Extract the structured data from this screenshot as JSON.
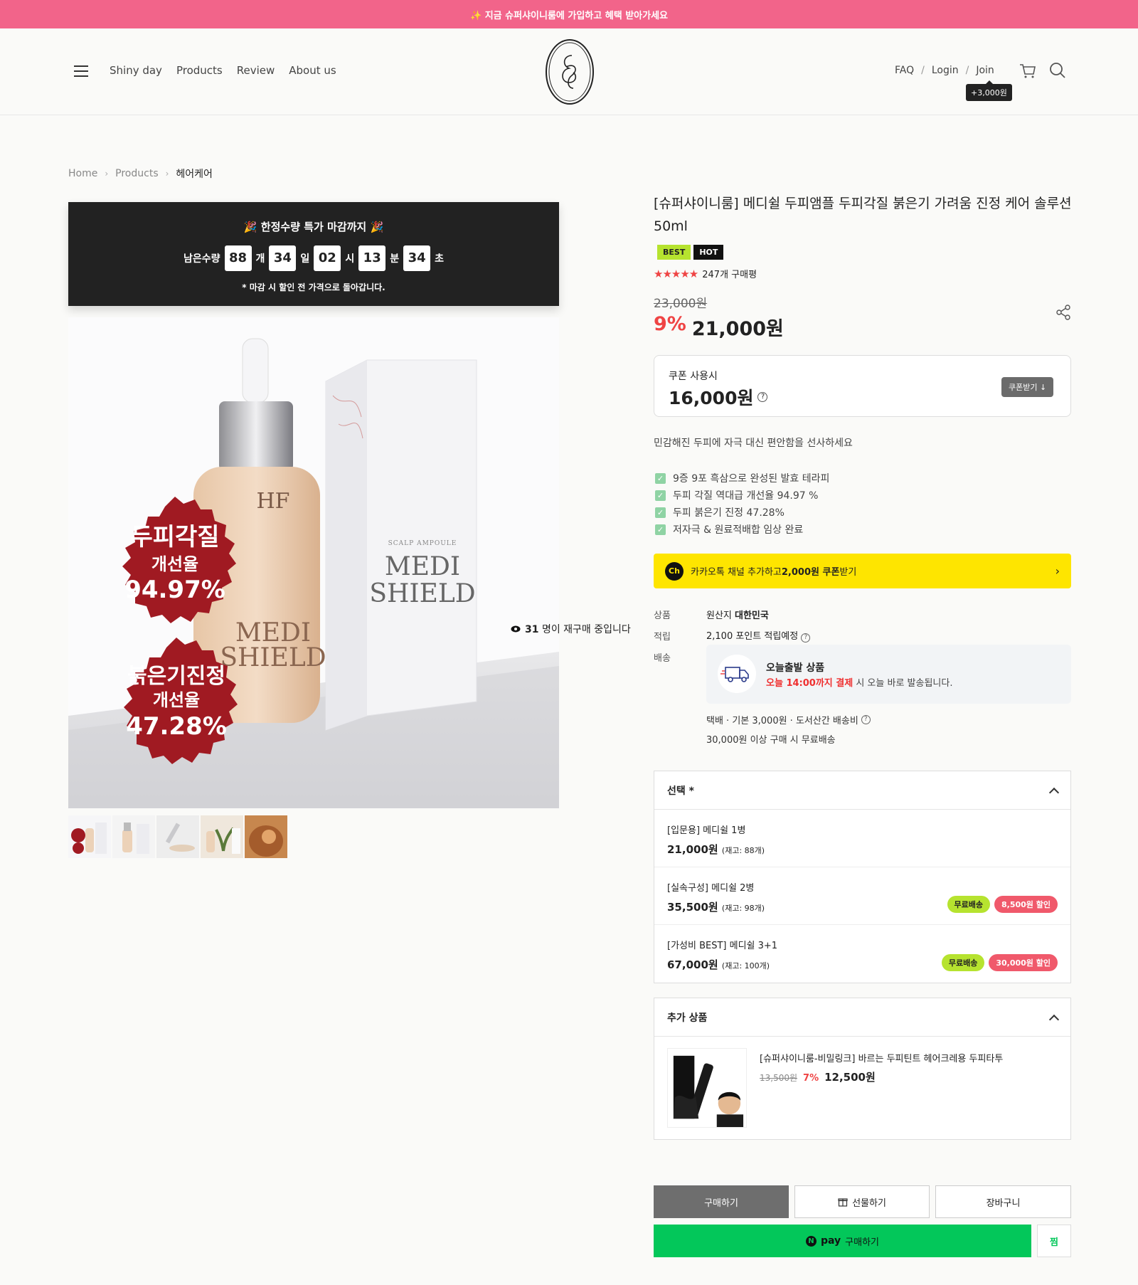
{
  "topbar": {
    "text": "✨ 지금 슈퍼샤이니룸에 가입하고 혜택 받아가세요"
  },
  "nav": {
    "items": [
      "Shiny day",
      "Products",
      "Review",
      "About us"
    ]
  },
  "util": {
    "faq": "FAQ",
    "login": "Login",
    "join": "Join",
    "join_tip": "+3,000원",
    "sep": "/"
  },
  "breadcrumb": {
    "home": "Home",
    "products": "Products",
    "current": "헤어케어"
  },
  "countdown": {
    "title": "🎉 한정수량 특가 마감까지 🎉",
    "remain_label": "남은수량",
    "qty": "88",
    "qty_unit": "개",
    "days": "34",
    "days_unit": "일",
    "hours": "02",
    "hours_unit": "시",
    "minutes": "13",
    "minutes_unit": "분",
    "seconds": "34",
    "seconds_unit": "초",
    "note": "* 마감 시 할인 전 가격으로 돌아갑니다."
  },
  "image": {
    "seal1_line1": "두피각질",
    "seal1_line2": "개선율",
    "seal1_line3": "94.97%",
    "seal2_line1": "붉은기진정",
    "seal2_line2": "개선율",
    "seal2_line3": "47.28%",
    "bottle_brand": "HF",
    "box_brand": "MEDI SHIELD",
    "box_sub": "SCALP AMPOULE"
  },
  "viewers": {
    "count": "31",
    "text": "명이 재구매 중입니다"
  },
  "product": {
    "title": "[슈퍼샤이니룸] 메디쉴 두피앰플 두피각질 붉은기 가려움 진정 케어 솔루션 50ml",
    "badge_best": "BEST",
    "badge_hot": "HOT",
    "stars": "★★★★★",
    "review_count": "247개 구매평",
    "old_price": "23,000원",
    "discount": "9%",
    "price": "21,000원"
  },
  "coupon": {
    "label": "쿠폰 사용시",
    "price": "16,000원",
    "qm": "?",
    "button": "쿠폰받기 ↓"
  },
  "desc": "민감해진 두피에 자극 대신 편안함을 선사하세요",
  "checks": [
    "9증 9포 흑삼으로 완성된 발효 테라피",
    "두피 각질 역대급 개선율 94.97 %",
    "두피 붉은기 진정 47.28%",
    "저자극 & 원료적배합 임상 완료"
  ],
  "kakao": {
    "ch": "Ch",
    "pre": "카카오톡 채널 추가하고 ",
    "bold": "2,000원 쿠폰",
    "post": " 받기",
    "arrow": "›"
  },
  "info": {
    "origin_k": "상품",
    "origin_v_pre": "원산지 ",
    "origin_v": "대한민국",
    "point_k": "적립",
    "point_v": "2,100 포인트 적립예정",
    "ship_k": "배송",
    "ship_title": "오늘출발 상품",
    "ship_red": "오늘 14:00까지 결제",
    "ship_rest": " 시 오늘 바로 발송됩니다.",
    "ship_line1": "택배 · 기본 3,000원 · 도서산간 배송비",
    "ship_line2": "30,000원 이상 구매 시 무료배송"
  },
  "options": {
    "header": "선택 *",
    "items": [
      {
        "name": "[입문용] 메디쉴 1병",
        "price": "21,000원",
        "stock": "(재고: 88개)",
        "free": "",
        "disc": ""
      },
      {
        "name": "[실속구성] 메디쉴 2병",
        "price": "35,500원",
        "stock": "(재고: 98개)",
        "free": "무료배송",
        "disc": "8,500원 할인"
      },
      {
        "name": "[가성비 BEST] 메디쉴 3+1",
        "price": "67,000원",
        "stock": "(재고: 100개)",
        "free": "무료배송",
        "disc": "30,000원 할인"
      }
    ]
  },
  "addon": {
    "header": "추가 상품",
    "name": "[슈퍼샤이니룸-비밀링크] 바르는 두피틴트 헤어크레용 두피타투",
    "old_price": "13,500원",
    "discount": "7%",
    "price": "12,500원"
  },
  "actions": {
    "buy": "구매하기",
    "gift": "선물하기",
    "cart": "장바구니",
    "npay_word": "pay",
    "npay_text": "구매하기",
    "npay_n": "N",
    "wish": "찜"
  },
  "colors": {
    "topbar": "#f2648a",
    "accent_red": "#ef4444",
    "npay": "#03c75a",
    "kakao": "#fee500",
    "best": "#b6e32f",
    "hot": "#111111"
  }
}
